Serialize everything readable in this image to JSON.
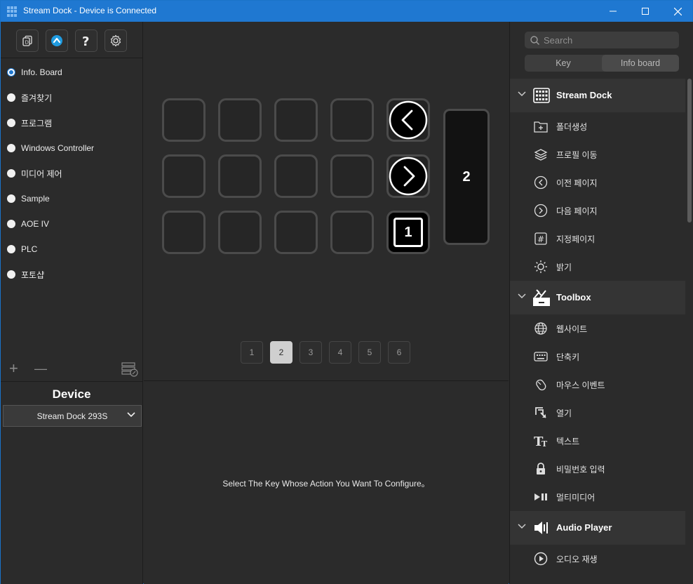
{
  "window": {
    "title": "Stream Dock - Device is Connected"
  },
  "profiles": [
    {
      "label": "Info. Board",
      "selected": true
    },
    {
      "label": "즐겨찾기",
      "selected": false
    },
    {
      "label": "프로그램",
      "selected": false
    },
    {
      "label": "Windows Controller",
      "selected": false
    },
    {
      "label": "미디어 제어",
      "selected": false
    },
    {
      "label": "Sample",
      "selected": false
    },
    {
      "label": "AOE IV",
      "selected": false
    },
    {
      "label": "PLC",
      "selected": false
    },
    {
      "label": "포토샵",
      "selected": false
    }
  ],
  "list_actions": {
    "add": "+",
    "remove": "—"
  },
  "device": {
    "title": "Device",
    "selected": "Stream Dock 293S"
  },
  "keypad": {
    "page_key_label": "1",
    "knob_label": "2"
  },
  "pager": {
    "pages": [
      "1",
      "2",
      "3",
      "4",
      "5",
      "6"
    ],
    "active": 2
  },
  "config": {
    "message": "Select The Key Whose Action You Want To Configure。"
  },
  "search": {
    "placeholder": "Search"
  },
  "tabs": {
    "key": "Key",
    "info_board": "Info board"
  },
  "groups": [
    {
      "name": "Stream Dock",
      "icon": "keyboard-grid-icon",
      "items": [
        {
          "label": "폴더생성",
          "icon": "folder-plus-icon"
        },
        {
          "label": "프로필 이동",
          "icon": "layers-icon"
        },
        {
          "label": "이전 페이지",
          "icon": "chevron-left-circle-icon"
        },
        {
          "label": "다음 페이지",
          "icon": "chevron-right-circle-icon"
        },
        {
          "label": "지정페이지",
          "icon": "hash-icon"
        },
        {
          "label": "밝기",
          "icon": "brightness-icon"
        }
      ]
    },
    {
      "name": "Toolbox",
      "icon": "toolbox-icon",
      "items": [
        {
          "label": "웹사이트",
          "icon": "globe-icon"
        },
        {
          "label": "단축키",
          "icon": "keyboard-icon"
        },
        {
          "label": "마우스 이벤트",
          "icon": "mouse-icon"
        },
        {
          "label": "열기",
          "icon": "open-icon"
        },
        {
          "label": "텍스트",
          "icon": "text-icon"
        },
        {
          "label": "비밀번호 입력",
          "icon": "lock-icon"
        },
        {
          "label": "멀티미디어",
          "icon": "play-pause-icon"
        }
      ]
    },
    {
      "name": "Audio Player",
      "icon": "speaker-icon",
      "items": [
        {
          "label": "오디오 재생",
          "icon": "play-circle-icon"
        }
      ]
    }
  ],
  "colors": {
    "titlebar": "#1f78d1",
    "accent": "#1f78d1",
    "background": "#2b2b2b"
  }
}
